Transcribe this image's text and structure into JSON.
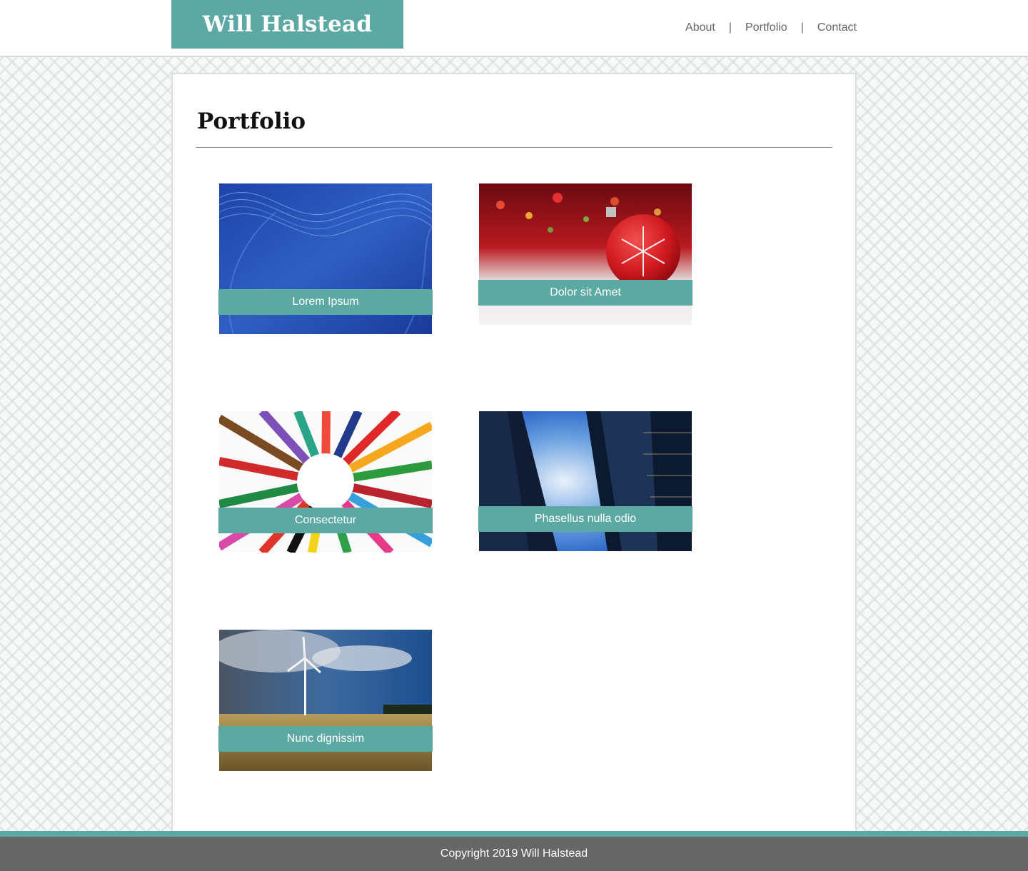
{
  "header": {
    "logo": "Will Halstead",
    "nav": [
      {
        "label": "About"
      },
      {
        "label": "Portfolio"
      },
      {
        "label": "Contact"
      }
    ],
    "separator": "|"
  },
  "main": {
    "title": "Portfolio",
    "items": [
      {
        "caption": "Lorem Ipsum",
        "image": "blue-abstract-waves"
      },
      {
        "caption": "Dolor sit Amet",
        "image": "red-christmas-ornament"
      },
      {
        "caption": "Consectetur",
        "image": "colored-pencils-circle"
      },
      {
        "caption": "Phasellus nulla odio",
        "image": "skyscrapers-looking-up"
      },
      {
        "caption": "Nunc dignissim",
        "image": "wind-turbine-field"
      }
    ]
  },
  "footer": {
    "text": "Copyright 2019 Will Halstead"
  },
  "colors": {
    "accent": "#5ca9a3",
    "footer_bg": "#666666",
    "nav_text": "#666666"
  }
}
